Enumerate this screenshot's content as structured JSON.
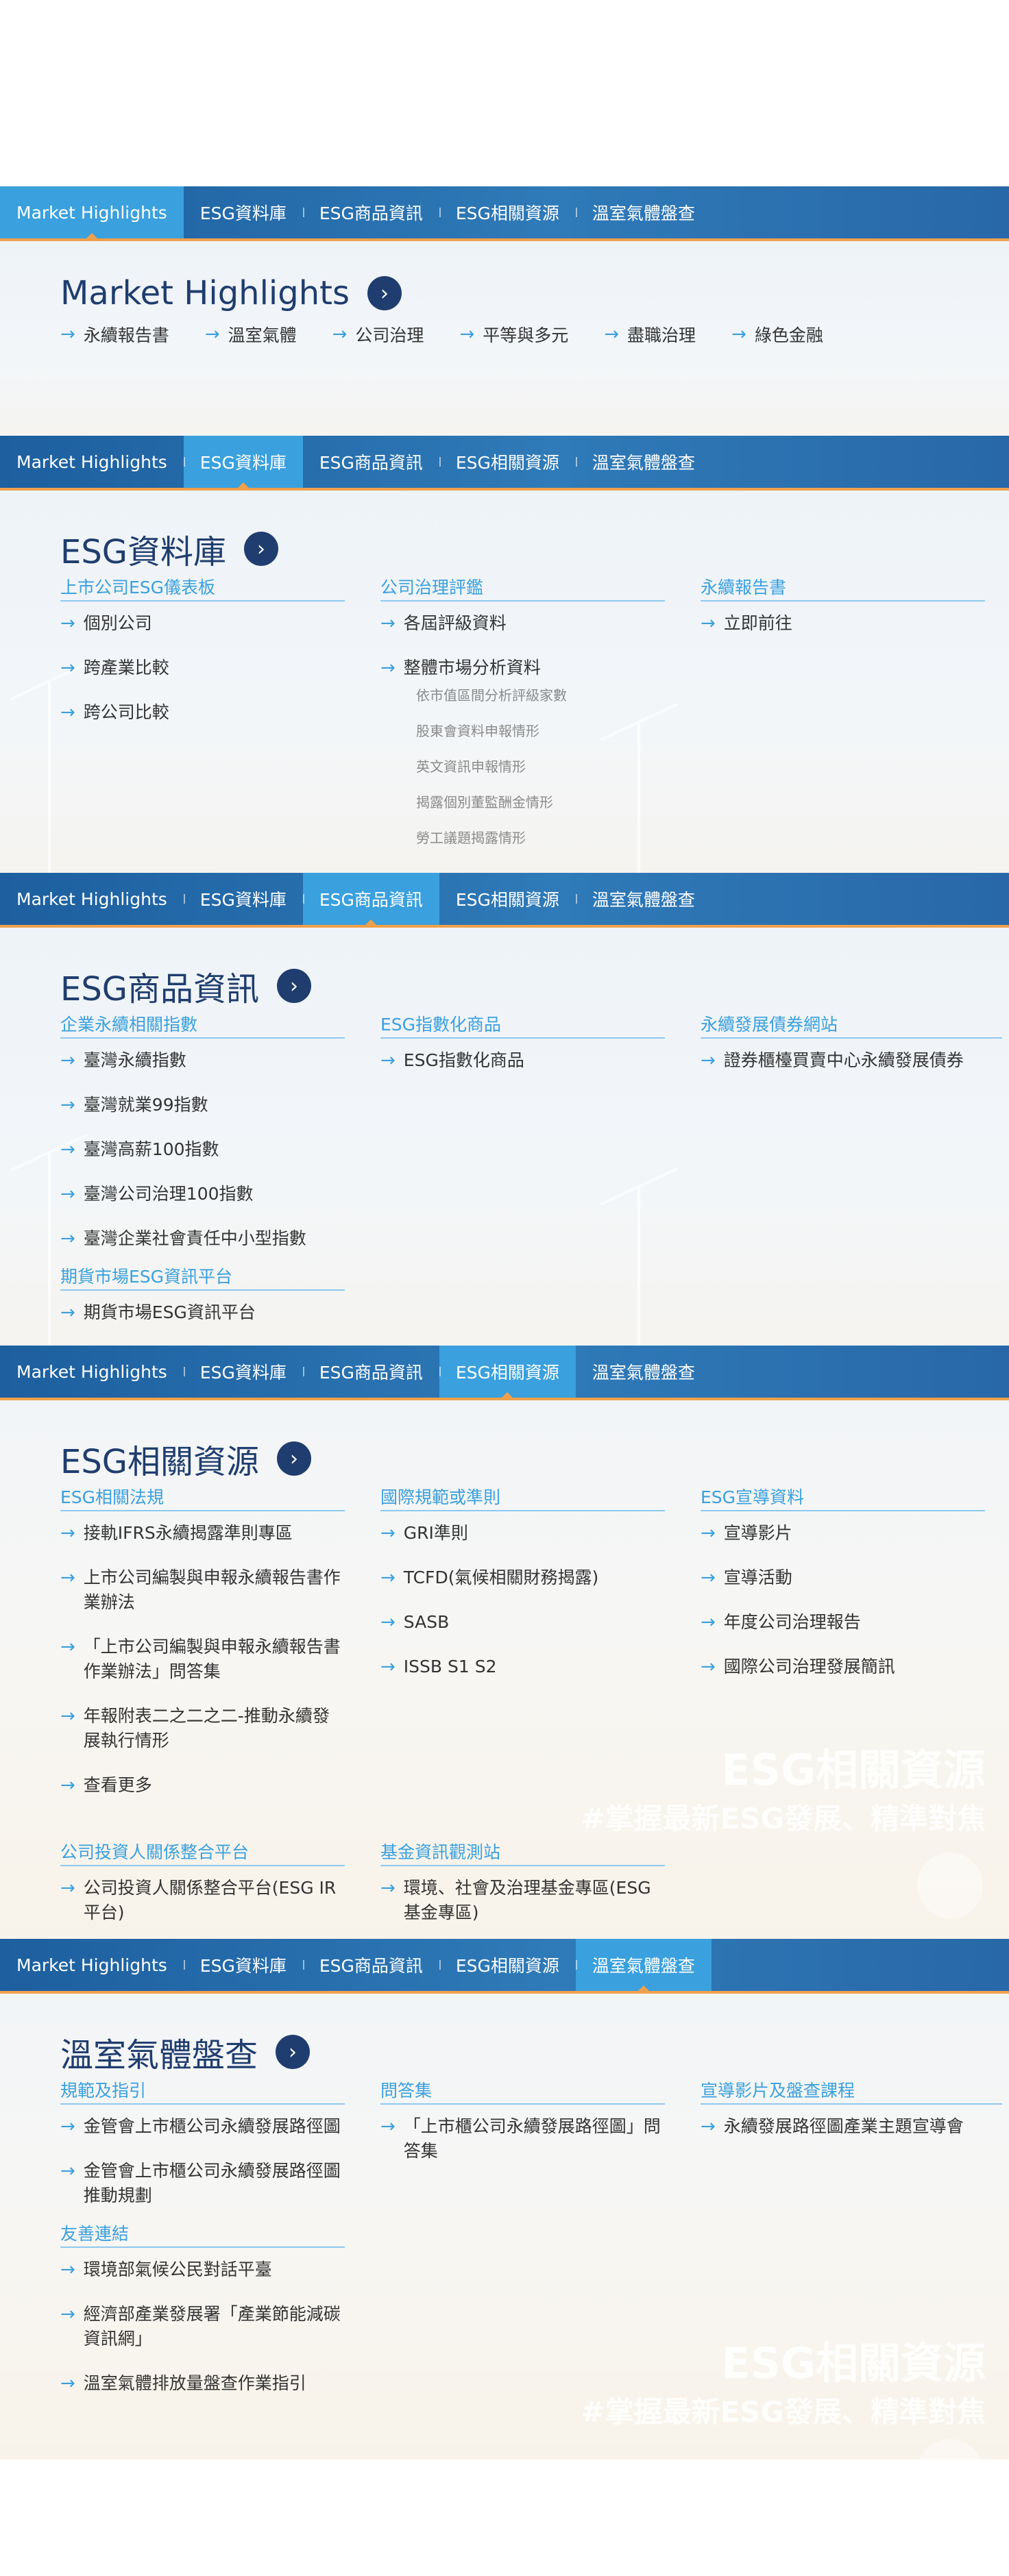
{
  "nav_tabs": [
    "Market Highlights",
    "ESG資料庫",
    "ESG商品資訊",
    "ESG相關資源",
    "溫室氣體盤查"
  ],
  "go_icon": "chevron-right-icon",
  "arrow_icon": "arrow-right-icon",
  "market_highlights": {
    "title": "Market Highlights",
    "links": [
      "永續報告書",
      "溫室氣體",
      "公司治理",
      "平等與多元",
      "盡職治理",
      "綠色金融"
    ]
  },
  "esg_database": {
    "title": "ESG資料庫",
    "columns": [
      {
        "title": "上市公司ESG儀表板",
        "items": [
          "個別公司",
          "跨產業比較",
          "跨公司比較"
        ]
      },
      {
        "title": "公司治理評鑑",
        "items": [
          "各屆評級資料",
          "整體市場分析資料"
        ],
        "sub_items": [
          "依市值區間分析評級家數",
          "股東會資料申報情形",
          "英文資訊申報情形",
          "揭露個別董監酬金情形",
          "勞工議題揭露情形"
        ]
      },
      {
        "title": "永續報告書",
        "items": [
          "立即前往"
        ]
      }
    ]
  },
  "esg_products": {
    "title": "ESG商品資訊",
    "columns": [
      {
        "title": "企業永續相關指數",
        "items": [
          "臺灣永續指數",
          "臺灣就業99指數",
          "臺灣高薪100指數",
          "臺灣公司治理100指數",
          "臺灣企業社會責任中小型指數"
        ]
      },
      {
        "title": "ESG指數化商品",
        "items": [
          "ESG指數化商品"
        ]
      },
      {
        "title": "永續發展債券網站",
        "items": [
          "證券櫃檯買賣中心永續發展債券"
        ]
      }
    ],
    "futures": {
      "title": "期貨市場ESG資訊平台",
      "items": [
        "期貨市場ESG資訊平台"
      ]
    }
  },
  "esg_resources": {
    "title": "ESG相關資源",
    "columns": [
      {
        "title": "ESG相關法規",
        "items": [
          "接軌IFRS永續揭露準則專區",
          "上市公司編製與申報永續報告書作業辦法",
          "「上市公司編製與申報永續報告書作業辦法」問答集",
          "年報附表二之二之二-推動永續發展執行情形",
          "查看更多"
        ]
      },
      {
        "title": "國際規範或準則",
        "items": [
          "GRI準則",
          "TCFD(氣候相關財務揭露)",
          "SASB",
          "ISSB S1 S2"
        ]
      },
      {
        "title": "ESG宣導資料",
        "items": [
          "宣導影片",
          "宣導活動",
          "年度公司治理報告",
          "國際公司治理發展簡訊"
        ]
      }
    ],
    "bottom_columns": [
      {
        "title": "公司投資人關係整合平台",
        "items": [
          "公司投資人關係整合平台(ESG IR平台)"
        ]
      },
      {
        "title": "基金資訊觀測站",
        "items": [
          "環境、社會及治理基金專區(ESG基金專區)"
        ]
      }
    ],
    "watermark": [
      "ESG相關資源",
      "#掌握最新ESG發展、精準對焦"
    ]
  },
  "ghg": {
    "title": "溫室氣體盤查",
    "columns": [
      {
        "title": "規範及指引",
        "items": [
          "金管會上市櫃公司永續發展路徑圖",
          "金管會上市櫃公司永續發展路徑圖推動規劃"
        ]
      },
      {
        "title": "問答集",
        "items": [
          "「上市櫃公司永續發展路徑圖」問答集"
        ]
      },
      {
        "title": "宣導影片及盤查課程",
        "items": [
          "永續發展路徑圖產業主題宣導會"
        ]
      }
    ],
    "links_section": {
      "title": "友善連結",
      "items": [
        "環境部氣候公民對話平臺",
        "經濟部產業發展署「產業節能減碳資訊網」",
        "溫室氣體排放量盤查作業指引"
      ]
    },
    "watermark": [
      "ESG相關資源",
      "#掌握最新ESG發展、精準對焦"
    ]
  },
  "colors": {
    "nav_blue": "#1d5f9f",
    "active_tab": "#3aa0de",
    "accent_orange": "#f0a04b",
    "title_navy": "#1f3d6e",
    "link_blue": "#3aa0de"
  }
}
